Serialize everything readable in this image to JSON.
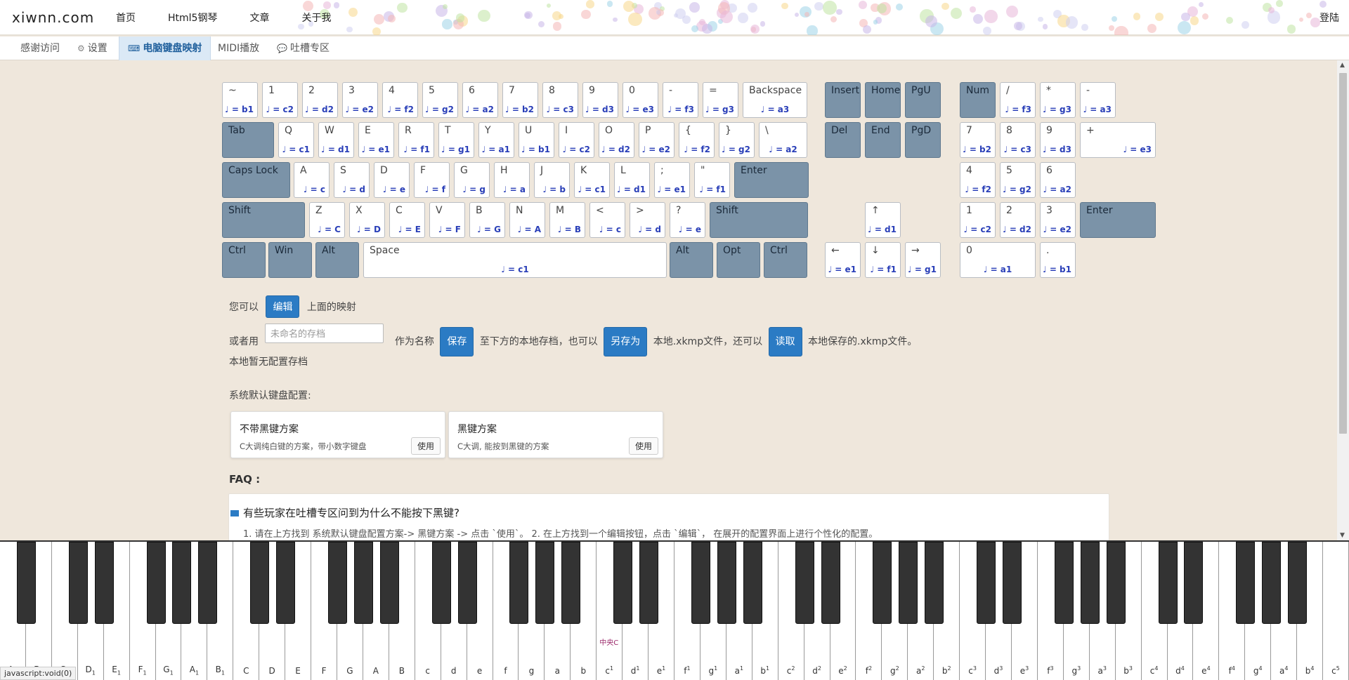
{
  "nav": {
    "brand": "xiwnn.com",
    "links": [
      "首页",
      "Html5钢琴",
      "文章",
      "关于我"
    ],
    "login": "登陆"
  },
  "tabs": [
    {
      "label": "感谢访问",
      "icon": ""
    },
    {
      "label": "设置",
      "icon": "gear-icon"
    },
    {
      "label": "电脑键盘映射",
      "icon": "keyboard-icon",
      "active": true
    },
    {
      "label": "MIDI播放",
      "icon": ""
    },
    {
      "label": "吐槽专区",
      "icon": "comment-icon"
    }
  ],
  "keyboard": {
    "rows": [
      [
        {
          "label": "~",
          "note": "♩ = b1"
        },
        {
          "label": "1",
          "note": "♩ = c2"
        },
        {
          "label": "2",
          "note": "♩ = d2"
        },
        {
          "label": "3",
          "note": "♩ = e2"
        },
        {
          "label": "4",
          "note": "♩ = f2"
        },
        {
          "label": "5",
          "note": "♩ = g2"
        },
        {
          "label": "6",
          "note": "♩ = a2"
        },
        {
          "label": "7",
          "note": "♩ = b2"
        },
        {
          "label": "8",
          "note": "♩ = c3"
        },
        {
          "label": "9",
          "note": "♩ = d3"
        },
        {
          "label": "0",
          "note": "♩ = e3"
        },
        {
          "label": "-",
          "note": "♩ = f3"
        },
        {
          "label": "=",
          "note": "♩ = g3"
        },
        {
          "label": "Backspace",
          "note": "♩ = a3"
        }
      ],
      [
        {
          "label": "Tab",
          "note": ""
        },
        {
          "label": "Q",
          "note": "♩ = c1"
        },
        {
          "label": "W",
          "note": "♩ = d1"
        },
        {
          "label": "E",
          "note": "♩ = e1"
        },
        {
          "label": "R",
          "note": "♩ = f1"
        },
        {
          "label": "T",
          "note": "♩ = g1"
        },
        {
          "label": "Y",
          "note": "♩ = a1"
        },
        {
          "label": "U",
          "note": "♩ = b1"
        },
        {
          "label": "I",
          "note": "♩ = c2"
        },
        {
          "label": "O",
          "note": "♩ = d2"
        },
        {
          "label": "P",
          "note": "♩ = e2"
        },
        {
          "label": "{",
          "note": "♩ = f2"
        },
        {
          "label": "}",
          "note": "♩ = g2"
        },
        {
          "label": "\\",
          "note": "♩ = a2"
        }
      ],
      [
        {
          "label": "Caps Lock",
          "note": ""
        },
        {
          "label": "A",
          "note": "♩ = c"
        },
        {
          "label": "S",
          "note": "♩ = d"
        },
        {
          "label": "D",
          "note": "♩ = e"
        },
        {
          "label": "F",
          "note": "♩ = f"
        },
        {
          "label": "G",
          "note": "♩ = g"
        },
        {
          "label": "H",
          "note": "♩ = a"
        },
        {
          "label": "J",
          "note": "♩ = b"
        },
        {
          "label": "K",
          "note": "♩ = c1"
        },
        {
          "label": "L",
          "note": "♩ = d1"
        },
        {
          "label": ";",
          "note": "♩ = e1"
        },
        {
          "label": "\"",
          "note": "♩ = f1"
        },
        {
          "label": "Enter",
          "note": ""
        }
      ],
      [
        {
          "label": "Shift",
          "note": ""
        },
        {
          "label": "Z",
          "note": "♩ = C"
        },
        {
          "label": "X",
          "note": "♩ = D"
        },
        {
          "label": "C",
          "note": "♩ = E"
        },
        {
          "label": "V",
          "note": "♩ = F"
        },
        {
          "label": "B",
          "note": "♩ = G"
        },
        {
          "label": "N",
          "note": "♩ = A"
        },
        {
          "label": "M",
          "note": "♩ = B"
        },
        {
          "label": "<",
          "note": "♩ = c"
        },
        {
          "label": ">",
          "note": "♩ = d"
        },
        {
          "label": "?",
          "note": "♩ = e"
        },
        {
          "label": "Shift",
          "note": ""
        }
      ],
      [
        {
          "label": "Ctrl",
          "note": ""
        },
        {
          "label": "Win",
          "note": ""
        },
        {
          "label": "Alt",
          "note": ""
        },
        {
          "label": "Space",
          "note": "♩ = c1"
        },
        {
          "label": "Alt",
          "note": ""
        },
        {
          "label": "Opt",
          "note": ""
        },
        {
          "label": "Ctrl",
          "note": ""
        }
      ]
    ],
    "nav_keys": [
      {
        "label": "Insert",
        "note": ""
      },
      {
        "label": "Home",
        "note": ""
      },
      {
        "label": "PgU",
        "note": ""
      },
      {
        "label": "Del",
        "note": ""
      },
      {
        "label": "End",
        "note": ""
      },
      {
        "label": "PgD",
        "note": ""
      },
      {
        "label": "↑",
        "note": "♩ = d1"
      },
      {
        "label": "←",
        "note": "♩ = e1"
      },
      {
        "label": "↓",
        "note": "♩ = f1"
      },
      {
        "label": "→",
        "note": "♩ = g1"
      }
    ],
    "numpad": [
      {
        "label": "Num",
        "note": ""
      },
      {
        "label": "/",
        "note": "♩ = f3"
      },
      {
        "label": "*",
        "note": "♩ = g3"
      },
      {
        "label": "-",
        "note": "♩ = a3"
      },
      {
        "label": "7",
        "note": "♩ = b2"
      },
      {
        "label": "8",
        "note": "♩ = c3"
      },
      {
        "label": "9",
        "note": "♩ = d3"
      },
      {
        "label": "+",
        "note": "♩ = e3"
      },
      {
        "label": "4",
        "note": "♩ = f2"
      },
      {
        "label": "5",
        "note": "♩ = g2"
      },
      {
        "label": "6",
        "note": "♩ = a2"
      },
      {
        "label": "1",
        "note": "♩ = c2"
      },
      {
        "label": "2",
        "note": "♩ = d2"
      },
      {
        "label": "3",
        "note": "♩ = e2"
      },
      {
        "label": "Enter",
        "note": ""
      },
      {
        "label": "0",
        "note": "♩ = a1"
      },
      {
        "label": ".",
        "note": "♩ = b1"
      }
    ]
  },
  "edit_row": {
    "prefix": "您可以",
    "button": "编辑",
    "suffix": "上面的映射"
  },
  "save_row": {
    "t1": "或者用",
    "placeholder": "未命名的存档",
    "t2": "作为名称",
    "save": "保存",
    "t3": "至下方的本地存档，也可以",
    "save_as": "另存为",
    "t4": "本地.xkmp文件，还可以",
    "load": "读取",
    "t5": "本地保存的.xkmp文件。"
  },
  "no_saves": "本地暂无配置存档",
  "default_title": "系统默认键盘配置:",
  "presets": [
    {
      "title": "不带黑键方案",
      "desc": "C大调纯白键的方案，带小数字键盘",
      "button": "使用"
    },
    {
      "title": "黑键方案",
      "desc": "C大调, 能按到黑键的方案",
      "button": "使用"
    }
  ],
  "faq": {
    "heading": "FAQ :",
    "question": "有些玩家在吐槽专区问到为什么不能按下黑键?",
    "answer": "1. 请在上方找到 系统默认键盘配置方案-> 黑键方案 -> 点击 `使用`。 2. 在上方找到一个编辑按钮，点击 `编辑`， 在展开的配置界面上进行个性化的配置。"
  },
  "piano": {
    "white_keys": [
      {
        "n": "A",
        "sub": "2",
        "sup": ""
      },
      {
        "n": "B",
        "sub": "2",
        "sup": ""
      },
      {
        "n": "C",
        "sub": "1",
        "sup": ""
      },
      {
        "n": "D",
        "sub": "1",
        "sup": ""
      },
      {
        "n": "E",
        "sub": "1",
        "sup": ""
      },
      {
        "n": "F",
        "sub": "1",
        "sup": ""
      },
      {
        "n": "G",
        "sub": "1",
        "sup": ""
      },
      {
        "n": "A",
        "sub": "1",
        "sup": ""
      },
      {
        "n": "B",
        "sub": "1",
        "sup": ""
      },
      {
        "n": "C",
        "sub": "",
        "sup": ""
      },
      {
        "n": "D",
        "sub": "",
        "sup": ""
      },
      {
        "n": "E",
        "sub": "",
        "sup": ""
      },
      {
        "n": "F",
        "sub": "",
        "sup": ""
      },
      {
        "n": "G",
        "sub": "",
        "sup": ""
      },
      {
        "n": "A",
        "sub": "",
        "sup": ""
      },
      {
        "n": "B",
        "sub": "",
        "sup": ""
      },
      {
        "n": "c",
        "sub": "",
        "sup": ""
      },
      {
        "n": "d",
        "sub": "",
        "sup": ""
      },
      {
        "n": "e",
        "sub": "",
        "sup": ""
      },
      {
        "n": "f",
        "sub": "",
        "sup": ""
      },
      {
        "n": "g",
        "sub": "",
        "sup": ""
      },
      {
        "n": "a",
        "sub": "",
        "sup": ""
      },
      {
        "n": "b",
        "sub": "",
        "sup": ""
      },
      {
        "n": "c",
        "sub": "",
        "sup": "1"
      },
      {
        "n": "d",
        "sub": "",
        "sup": "1"
      },
      {
        "n": "e",
        "sub": "",
        "sup": "1"
      },
      {
        "n": "f",
        "sub": "",
        "sup": "1"
      },
      {
        "n": "g",
        "sub": "",
        "sup": "1"
      },
      {
        "n": "a",
        "sub": "",
        "sup": "1"
      },
      {
        "n": "b",
        "sub": "",
        "sup": "1"
      },
      {
        "n": "c",
        "sub": "",
        "sup": "2"
      },
      {
        "n": "d",
        "sub": "",
        "sup": "2"
      },
      {
        "n": "e",
        "sub": "",
        "sup": "2"
      },
      {
        "n": "f",
        "sub": "",
        "sup": "2"
      },
      {
        "n": "g",
        "sub": "",
        "sup": "2"
      },
      {
        "n": "a",
        "sub": "",
        "sup": "2"
      },
      {
        "n": "b",
        "sub": "",
        "sup": "2"
      },
      {
        "n": "c",
        "sub": "",
        "sup": "3"
      },
      {
        "n": "d",
        "sub": "",
        "sup": "3"
      },
      {
        "n": "e",
        "sub": "",
        "sup": "3"
      },
      {
        "n": "f",
        "sub": "",
        "sup": "3"
      },
      {
        "n": "g",
        "sub": "",
        "sup": "3"
      },
      {
        "n": "a",
        "sub": "",
        "sup": "3"
      },
      {
        "n": "b",
        "sub": "",
        "sup": "3"
      },
      {
        "n": "c",
        "sub": "",
        "sup": "4"
      },
      {
        "n": "d",
        "sub": "",
        "sup": "4"
      },
      {
        "n": "e",
        "sub": "",
        "sup": "4"
      },
      {
        "n": "f",
        "sub": "",
        "sup": "4"
      },
      {
        "n": "g",
        "sub": "",
        "sup": "4"
      },
      {
        "n": "a",
        "sub": "",
        "sup": "4"
      },
      {
        "n": "b",
        "sub": "",
        "sup": "4"
      },
      {
        "n": "c",
        "sub": "",
        "sup": "5"
      }
    ],
    "middle_c_label": "中央C"
  },
  "status_url": "javascript:void(0)",
  "colors": {
    "accent": "#2b7bc4",
    "mod_key": "#7b93a8",
    "note_text": "#2a3fb8"
  }
}
